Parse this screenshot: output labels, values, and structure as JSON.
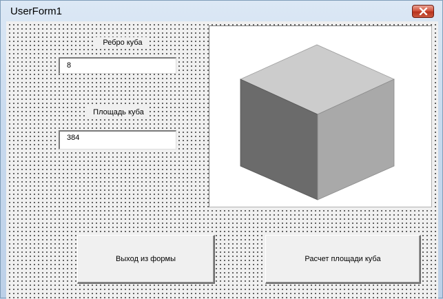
{
  "window": {
    "title": "UserForm1"
  },
  "edge_label": {
    "text": "Ребро куба"
  },
  "edge_input": {
    "value": "8"
  },
  "area_label": {
    "text": "Площадь куба"
  },
  "area_input": {
    "value": "384"
  },
  "buttons": {
    "exit_label": "Выход из формы",
    "calc_label": "Расчет площади куба"
  },
  "icons": {
    "close": "close-icon",
    "cube": "cube-image"
  },
  "colors": {
    "cube_top": "#cccccc",
    "cube_left": "#6b6b6b",
    "cube_right": "#a9a9a9",
    "close_button": "#c9452e"
  }
}
